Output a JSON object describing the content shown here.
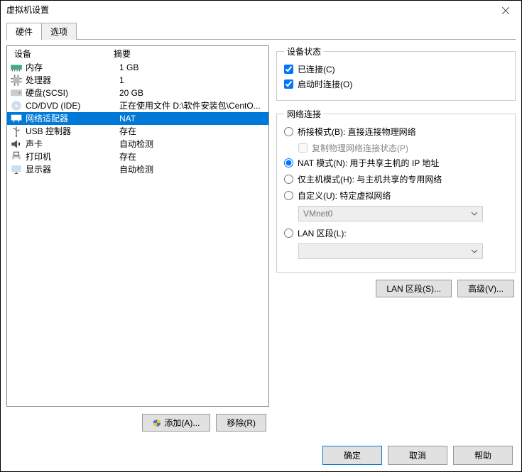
{
  "window": {
    "title": "虚拟机设置"
  },
  "tabs": {
    "hardware": "硬件",
    "options": "选项"
  },
  "list": {
    "headDevice": "设备",
    "headSummary": "摘要",
    "items": [
      {
        "name": "内存",
        "summary": "1 GB"
      },
      {
        "name": "处理器",
        "summary": "1"
      },
      {
        "name": "硬盘(SCSI)",
        "summary": "20 GB"
      },
      {
        "name": "CD/DVD (IDE)",
        "summary": "正在使用文件 D:\\软件安装包\\CentO..."
      },
      {
        "name": "网络适配器",
        "summary": "NAT"
      },
      {
        "name": "USB 控制器",
        "summary": "存在"
      },
      {
        "name": "声卡",
        "summary": "自动检测"
      },
      {
        "name": "打印机",
        "summary": "存在"
      },
      {
        "name": "显示器",
        "summary": "自动检测"
      }
    ]
  },
  "leftBtns": {
    "add": "添加(A)...",
    "remove": "移除(R)"
  },
  "status": {
    "legend": "设备状态",
    "connected": "已连接(C)",
    "connectAtPower": "启动时连接(O)"
  },
  "net": {
    "legend": "网络连接",
    "bridged": "桥接模式(B): 直接连接物理网络",
    "replicate": "复制物理网络连接状态(P)",
    "nat": "NAT 模式(N): 用于共享主机的 IP 地址",
    "hostonly": "仅主机模式(H): 与主机共享的专用网络",
    "custom": "自定义(U): 特定虚拟网络",
    "vmnet": "VMnet0",
    "lanseg": "LAN 区段(L):",
    "lanval": ""
  },
  "rightBtns": {
    "lanseg": "LAN 区段(S)...",
    "adv": "高级(V)..."
  },
  "footer": {
    "ok": "确定",
    "cancel": "取消",
    "help": "帮助"
  }
}
